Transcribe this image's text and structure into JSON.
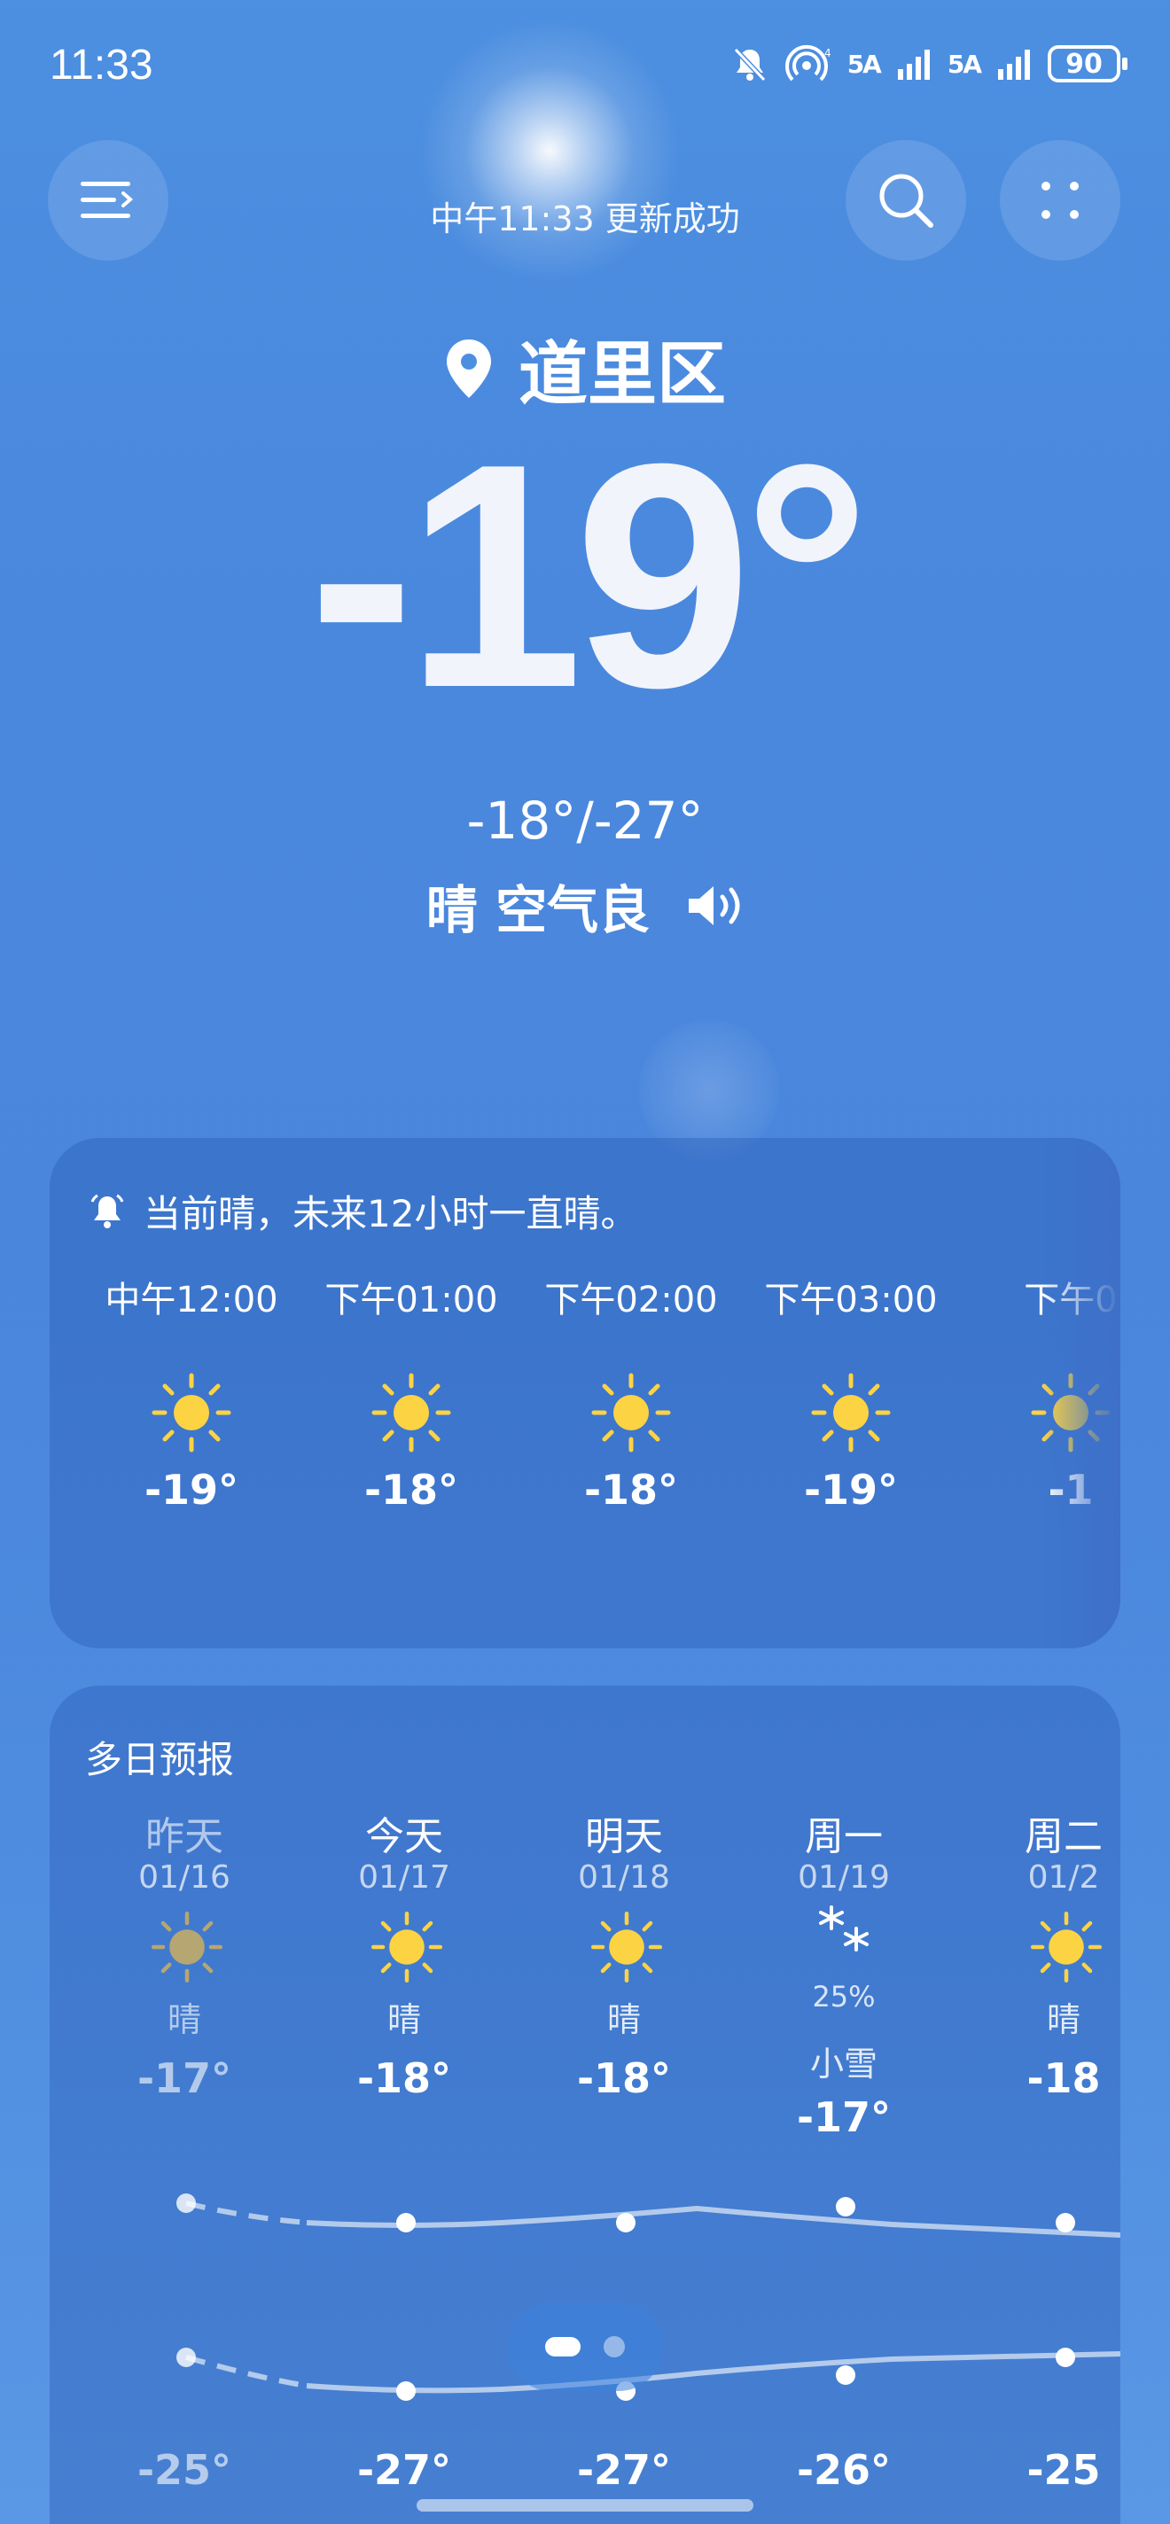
{
  "status_bar": {
    "time": "11:33",
    "signal_1": "5A",
    "signal_2": "5A",
    "battery": "90",
    "icons": [
      "mute-bell-icon",
      "hotspot-icon",
      "signal-icon",
      "battery-icon"
    ]
  },
  "header": {
    "update_text": "中午11:33 更新成功",
    "location": "道里区",
    "menu_icon": "menu-icon",
    "search_icon": "search-icon",
    "more_icon": "grid-dots-icon"
  },
  "current": {
    "temperature": "-19°",
    "range": "-18°/-27°",
    "condition": "晴 空气良",
    "speaker_icon": "speaker-icon"
  },
  "hourly": {
    "alert": "当前晴，未来12小时一直晴。",
    "items": [
      {
        "label": "中午12:00",
        "icon": "sun-icon",
        "temp": "-19°"
      },
      {
        "label": "下午01:00",
        "icon": "sun-icon",
        "temp": "-18°"
      },
      {
        "label": "下午02:00",
        "icon": "sun-icon",
        "temp": "-18°"
      },
      {
        "label": "下午03:00",
        "icon": "sun-icon",
        "temp": "-19°"
      },
      {
        "label": "下午0",
        "icon": "sun-icon",
        "temp": "-1"
      }
    ]
  },
  "daily": {
    "title": "多日预报",
    "items": [
      {
        "name": "昨天",
        "date": "01/16",
        "icon": "sun-icon",
        "pop": "",
        "condition": "晴",
        "high": "-17°",
        "low": "-25°"
      },
      {
        "name": "今天",
        "date": "01/17",
        "icon": "sun-icon",
        "pop": "",
        "condition": "晴",
        "high": "-18°",
        "low": "-27°"
      },
      {
        "name": "明天",
        "date": "01/18",
        "icon": "sun-icon",
        "pop": "",
        "condition": "晴",
        "high": "-18°",
        "low": "-27°"
      },
      {
        "name": "周一",
        "date": "01/19",
        "icon": "snow-icon",
        "pop": "25%",
        "condition": "小雪",
        "high": "-17°",
        "low": "-26°"
      },
      {
        "name": "周二",
        "date": "01/2",
        "icon": "sun-icon",
        "pop": "",
        "condition": "晴",
        "high": "-18",
        "low": "-25"
      }
    ]
  },
  "colors": {
    "sun": "#fcd343",
    "sun_past": "#b6a672",
    "background": "#4a88de"
  }
}
